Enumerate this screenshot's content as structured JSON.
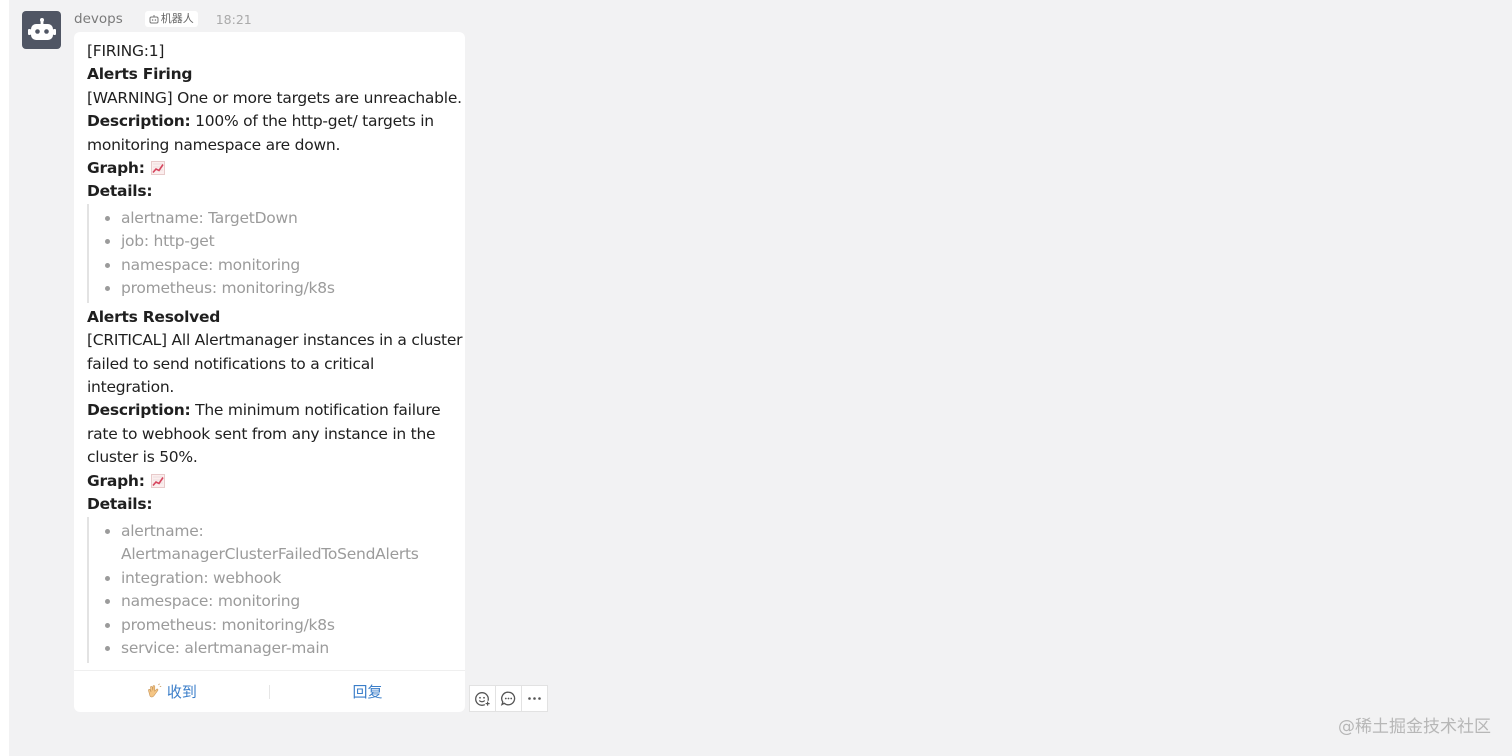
{
  "header": {
    "sender": "devops",
    "bot_tag": "机器人",
    "time": "18:21"
  },
  "message": {
    "firing_count": "[FIRING:1]",
    "firing_title": "Alerts Firing",
    "firing_summary": "[WARNING] One or more targets are unreachable.",
    "desc_label": "Description:",
    "firing_desc_line1": " 100% of the http-get/ targets in",
    "firing_desc_line2": "monitoring namespace are down.",
    "graph_label": "Graph:",
    "details_label": "Details:",
    "firing_details": [
      "alertname: TargetDown",
      "job: http-get",
      "namespace: monitoring",
      "prometheus: monitoring/k8s"
    ],
    "resolved_title": "Alerts Resolved",
    "resolved_summary_line1": "[CRITICAL] All Alertmanager instances in a cluster",
    "resolved_summary_line2": "failed to send notifications to a critical",
    "resolved_summary_line3": "integration.",
    "resolved_desc_line1": " The minimum notification failure",
    "resolved_desc_line2": "rate to webhook sent from any instance in the",
    "resolved_desc_line3": "cluster is 50%.",
    "resolved_details": [
      "alertname:",
      "AlertmanagerClusterFailedToSendAlerts",
      "integration: webhook",
      "namespace: monitoring",
      "prometheus: monitoring/k8s",
      "service: alertmanager-main"
    ]
  },
  "footer": {
    "ack_label": "收到",
    "reply_label": "回复"
  },
  "icons": {
    "avatar": "robot-icon",
    "graph": "chart-icon",
    "ack": "clap-hands-icon",
    "actions": [
      "emoji-icon",
      "comment-icon",
      "more-icon"
    ]
  },
  "colors": {
    "accent": "#3b7ec9",
    "avatar_bg": "#505664",
    "muted_text": "#9b9b9b"
  },
  "watermark": "@稀土掘金技术社区"
}
